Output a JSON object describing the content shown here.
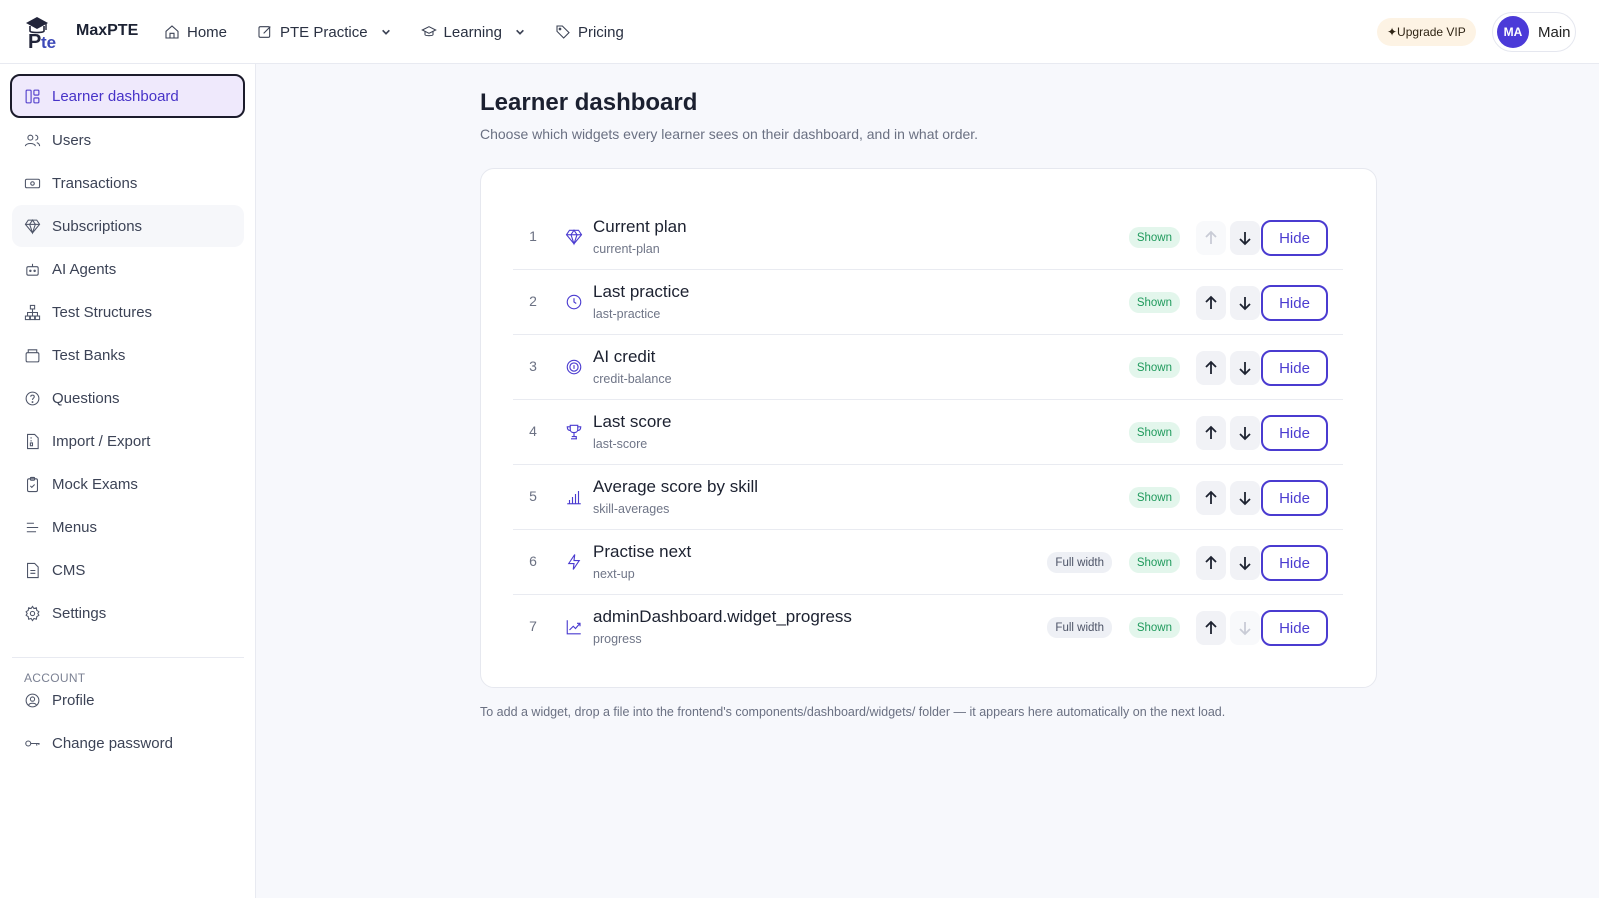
{
  "header": {
    "brand": "MaxPTE",
    "nav": [
      {
        "label": "Home",
        "icon": "home-icon"
      },
      {
        "label": "PTE Practice",
        "icon": "edit-icon",
        "dropdown": true
      },
      {
        "label": "Learning",
        "icon": "graduation-cap-icon",
        "dropdown": true
      },
      {
        "label": "Pricing",
        "icon": "tag-icon"
      }
    ],
    "upgrade_label": "✦Upgrade VIP",
    "user_initials": "MA",
    "user_name": "Main"
  },
  "sidebar": {
    "items": [
      {
        "label": "Learner dashboard",
        "icon": "layout-icon",
        "active": true
      },
      {
        "label": "Users",
        "icon": "users-icon"
      },
      {
        "label": "Transactions",
        "icon": "banknote-icon"
      },
      {
        "label": "Subscriptions",
        "icon": "gem-icon"
      },
      {
        "label": "AI Agents",
        "icon": "bot-icon"
      },
      {
        "label": "Test Structures",
        "icon": "network-icon"
      },
      {
        "label": "Test Banks",
        "icon": "archive-icon"
      },
      {
        "label": "Questions",
        "icon": "help-circle-icon"
      },
      {
        "label": "Import / Export",
        "icon": "file-archive-icon"
      },
      {
        "label": "Mock Exams",
        "icon": "clipboard-icon"
      },
      {
        "label": "Menus",
        "icon": "menu-icon"
      },
      {
        "label": "CMS",
        "icon": "file-text-icon"
      },
      {
        "label": "Settings",
        "icon": "settings-icon"
      }
    ],
    "account_heading": "ACCOUNT",
    "account_items": [
      {
        "label": "Profile",
        "icon": "user-circle-icon"
      },
      {
        "label": "Change password",
        "icon": "key-icon"
      }
    ]
  },
  "main": {
    "title": "Learner dashboard",
    "subtitle": "Choose which widgets every learner sees on their dashboard, and in what order.",
    "widgets": [
      {
        "num": "1",
        "title": "Current plan",
        "key": "current-plan",
        "icon": "gem-icon",
        "full_width": null,
        "status": "Shown",
        "up_disabled": true,
        "down_disabled": false,
        "action": "Hide"
      },
      {
        "num": "2",
        "title": "Last practice",
        "key": "last-practice",
        "icon": "clock-icon",
        "full_width": null,
        "status": "Shown",
        "up_disabled": false,
        "down_disabled": false,
        "action": "Hide"
      },
      {
        "num": "3",
        "title": "AI credit",
        "key": "credit-balance",
        "icon": "coin-icon",
        "full_width": null,
        "status": "Shown",
        "up_disabled": false,
        "down_disabled": false,
        "action": "Hide"
      },
      {
        "num": "4",
        "title": "Last score",
        "key": "last-score",
        "icon": "trophy-icon",
        "full_width": null,
        "status": "Shown",
        "up_disabled": false,
        "down_disabled": false,
        "action": "Hide"
      },
      {
        "num": "5",
        "title": "Average score by skill",
        "key": "skill-averages",
        "icon": "bar-chart-icon",
        "full_width": null,
        "status": "Shown",
        "up_disabled": false,
        "down_disabled": false,
        "action": "Hide"
      },
      {
        "num": "6",
        "title": "Practise next",
        "key": "next-up",
        "icon": "zap-icon",
        "full_width": "Full width",
        "status": "Shown",
        "up_disabled": false,
        "down_disabled": false,
        "action": "Hide"
      },
      {
        "num": "7",
        "title": "adminDashboard.widget_progress",
        "key": "progress",
        "icon": "trending-up-icon",
        "full_width": "Full width",
        "status": "Shown",
        "up_disabled": false,
        "down_disabled": true,
        "action": "Hide"
      }
    ],
    "footnote": "To add a widget, drop a file into the frontend's components/dashboard/widgets/ folder — it appears here automatically on the next load."
  }
}
